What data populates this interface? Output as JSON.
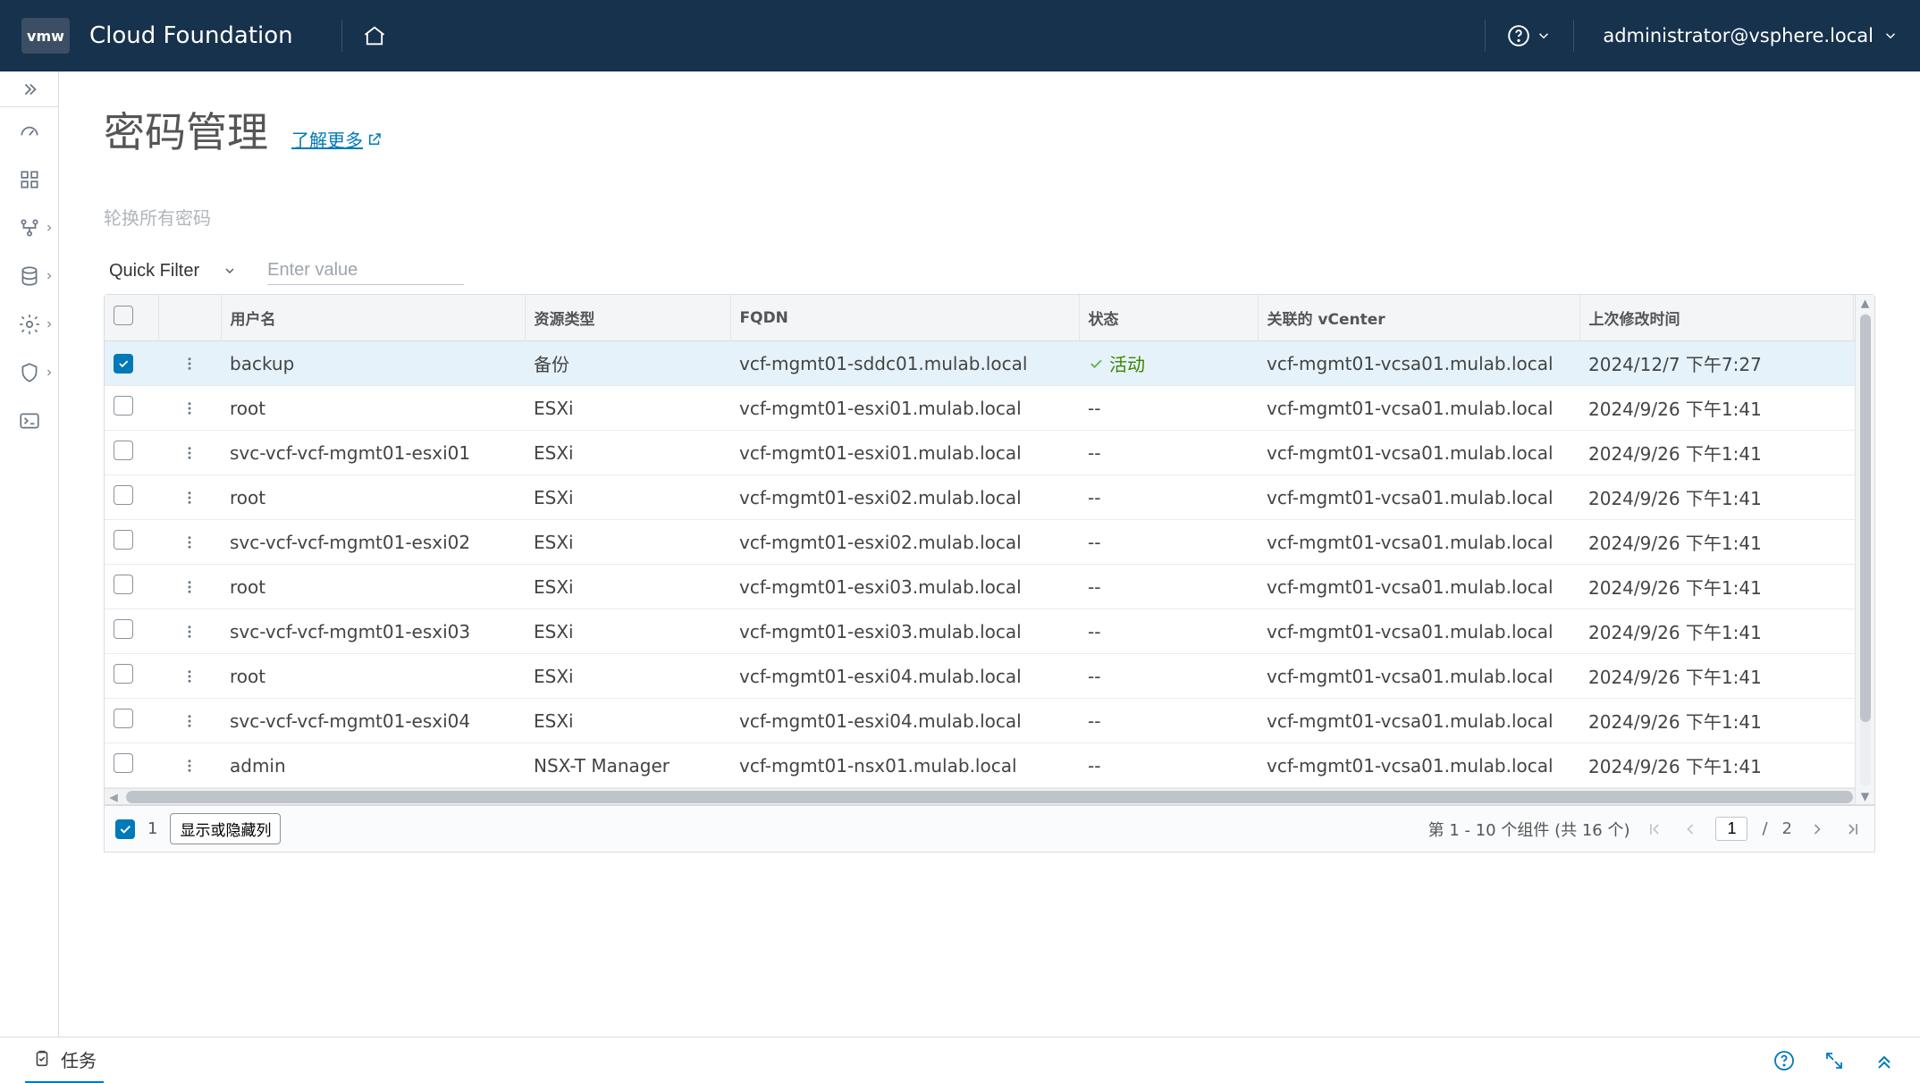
{
  "header": {
    "logo_text": "vmw",
    "product_name": "Cloud Foundation",
    "user_label": "administrator@vsphere.local"
  },
  "page": {
    "title": "密码管理",
    "learn_more": "了解更多",
    "rotate_all": "轮换所有密码",
    "quick_filter_label": "Quick Filter",
    "filter_placeholder": "Enter value"
  },
  "table": {
    "columns": {
      "user": "用户名",
      "resource_type": "资源类型",
      "fqdn": "FQDN",
      "status": "状态",
      "vcenter": "关联的 vCenter",
      "last_modified": "上次修改时间"
    },
    "status_active": "活动",
    "rows": [
      {
        "selected": true,
        "user": "backup",
        "type": "备份",
        "fqdn": "vcf-mgmt01-sddc01.mulab.local",
        "status": "active",
        "vcenter": "vcf-mgmt01-vcsa01.mulab.local",
        "modified": "2024/12/7 下午7:27"
      },
      {
        "selected": false,
        "user": "root",
        "type": "ESXi",
        "fqdn": "vcf-mgmt01-esxi01.mulab.local",
        "status": "--",
        "vcenter": "vcf-mgmt01-vcsa01.mulab.local",
        "modified": "2024/9/26 下午1:41"
      },
      {
        "selected": false,
        "user": "svc-vcf-vcf-mgmt01-esxi01",
        "type": "ESXi",
        "fqdn": "vcf-mgmt01-esxi01.mulab.local",
        "status": "--",
        "vcenter": "vcf-mgmt01-vcsa01.mulab.local",
        "modified": "2024/9/26 下午1:41"
      },
      {
        "selected": false,
        "user": "root",
        "type": "ESXi",
        "fqdn": "vcf-mgmt01-esxi02.mulab.local",
        "status": "--",
        "vcenter": "vcf-mgmt01-vcsa01.mulab.local",
        "modified": "2024/9/26 下午1:41"
      },
      {
        "selected": false,
        "user": "svc-vcf-vcf-mgmt01-esxi02",
        "type": "ESXi",
        "fqdn": "vcf-mgmt01-esxi02.mulab.local",
        "status": "--",
        "vcenter": "vcf-mgmt01-vcsa01.mulab.local",
        "modified": "2024/9/26 下午1:41"
      },
      {
        "selected": false,
        "user": "root",
        "type": "ESXi",
        "fqdn": "vcf-mgmt01-esxi03.mulab.local",
        "status": "--",
        "vcenter": "vcf-mgmt01-vcsa01.mulab.local",
        "modified": "2024/9/26 下午1:41"
      },
      {
        "selected": false,
        "user": "svc-vcf-vcf-mgmt01-esxi03",
        "type": "ESXi",
        "fqdn": "vcf-mgmt01-esxi03.mulab.local",
        "status": "--",
        "vcenter": "vcf-mgmt01-vcsa01.mulab.local",
        "modified": "2024/9/26 下午1:41"
      },
      {
        "selected": false,
        "user": "root",
        "type": "ESXi",
        "fqdn": "vcf-mgmt01-esxi04.mulab.local",
        "status": "--",
        "vcenter": "vcf-mgmt01-vcsa01.mulab.local",
        "modified": "2024/9/26 下午1:41"
      },
      {
        "selected": false,
        "user": "svc-vcf-vcf-mgmt01-esxi04",
        "type": "ESXi",
        "fqdn": "vcf-mgmt01-esxi04.mulab.local",
        "status": "--",
        "vcenter": "vcf-mgmt01-vcsa01.mulab.local",
        "modified": "2024/9/26 下午1:41"
      },
      {
        "selected": false,
        "user": "admin",
        "type": "NSX-T Manager",
        "fqdn": "vcf-mgmt01-nsx01.mulab.local",
        "status": "--",
        "vcenter": "vcf-mgmt01-vcsa01.mulab.local",
        "modified": "2024/9/26 下午1:41"
      }
    ]
  },
  "footer": {
    "selected_count": "1",
    "column_toggle": "显示或隐藏列",
    "range_text": "第 1 - 10 个组件 (共 16 个)",
    "page_value": "1",
    "page_total": "2"
  },
  "bottom": {
    "tasks_label": "任务"
  }
}
